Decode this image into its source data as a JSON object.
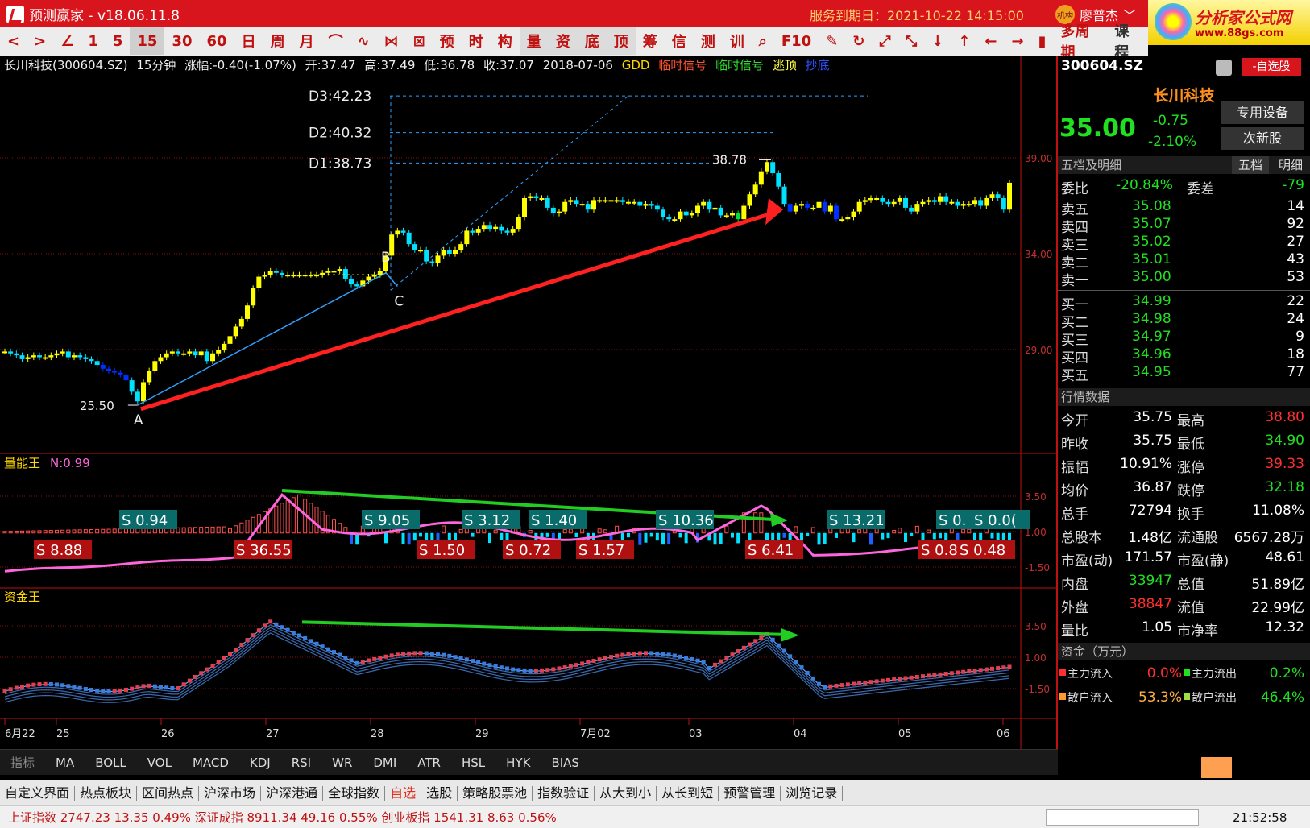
{
  "app": {
    "title": "预测赢家 - v18.06.11.8",
    "service_label": "服务到期日：2021-10-22 14:15:00",
    "user": "廖普杰",
    "user_badge": "机构",
    "ad_title": "分析家公式网",
    "ad_url": "www.88gs.com"
  },
  "toolbar": {
    "items": [
      "<",
      ">",
      "∠",
      "1",
      "5",
      "15",
      "30",
      "60",
      "日",
      "周",
      "月",
      "⌒",
      "∿",
      "⋈",
      "⊠",
      "预",
      "时",
      "构",
      "量",
      "资",
      "底",
      "顶",
      "筹",
      "信",
      "测",
      "训",
      "⌕",
      "F10",
      "✎",
      "↻",
      "⤢",
      "⤡",
      "↓",
      "↑",
      "←",
      "→",
      "▮",
      "多周期"
    ],
    "active_index": 5,
    "right_label": "课程"
  },
  "infobar": {
    "name": "长川科技(300604.SZ)",
    "period": "15分钟",
    "change": "涨幅:-0.40(-1.07%)",
    "open": "开:37.47",
    "high": "高:37.49",
    "low": "低:36.78",
    "close": "收:37.07",
    "date": "2018-07-06",
    "gdd": "GDD",
    "sig1": "临时信号",
    "sig2": "临时信号",
    "sig3": "逃顶",
    "sig4": "抄底"
  },
  "chart_data": [
    {
      "type": "candlestick",
      "title": "长川科技(300604.SZ) 15分钟",
      "ylim": [
        25.0,
        43.0
      ],
      "y_ticks": [
        "39.00",
        "34.00",
        "29.00"
      ],
      "x_ticks": [
        "6月22",
        "25",
        "26",
        "27",
        "28",
        "29",
        "7月02",
        "03",
        "04",
        "05",
        "06"
      ],
      "close": [
        28.9,
        28.8,
        28.7,
        28.5,
        28.6,
        28.7,
        28.6,
        28.6,
        28.7,
        28.8,
        28.9,
        28.6,
        28.7,
        28.6,
        28.5,
        28.4,
        28.2,
        28.0,
        27.9,
        27.8,
        27.7,
        27.4,
        26.8,
        26.3,
        27.3,
        27.9,
        28.4,
        28.6,
        28.8,
        28.9,
        28.8,
        28.8,
        28.9,
        28.7,
        28.9,
        28.4,
        28.8,
        29.0,
        29.3,
        29.7,
        30.2,
        30.6,
        31.3,
        32.2,
        32.8,
        32.9,
        33.1,
        33.0,
        32.9,
        32.9,
        32.9,
        32.9,
        32.9,
        32.9,
        32.9,
        33.0,
        33.1,
        33.1,
        33.2,
        32.7,
        32.4,
        32.3,
        32.6,
        32.8,
        32.9,
        33.1,
        33.9,
        35.0,
        35.2,
        35.1,
        34.5,
        34.2,
        34.2,
        33.6,
        33.5,
        33.9,
        34.2,
        34.0,
        34.2,
        34.5,
        35.2,
        35.1,
        35.3,
        35.5,
        35.3,
        35.4,
        35.2,
        35.1,
        35.3,
        35.9,
        36.9,
        37.0,
        36.9,
        36.9,
        36.4,
        36.1,
        36.2,
        36.7,
        36.8,
        36.6,
        36.6,
        36.3,
        36.8,
        36.8,
        36.8,
        36.8,
        36.8,
        36.7,
        36.7,
        36.7,
        36.5,
        36.6,
        36.5,
        36.3,
        35.9,
        35.8,
        35.8,
        36.2,
        36.0,
        36.1,
        36.5,
        36.7,
        36.3,
        36.4,
        36.0,
        36.0,
        36.1,
        35.8,
        36.5,
        37.1,
        37.6,
        38.3,
        38.78,
        38.2,
        37.5,
        36.6,
        36.2,
        36.5,
        36.6,
        36.4,
        36.4,
        36.7,
        36.2,
        36.5,
        35.8,
        35.8,
        35.9,
        36.2,
        36.7,
        36.8,
        36.9,
        36.9,
        36.7,
        36.6,
        36.7,
        36.9,
        36.4,
        36.2,
        36.6,
        36.7,
        36.8,
        36.7,
        37.0,
        36.7,
        36.7,
        36.5,
        36.6,
        36.6,
        36.8,
        36.5,
        36.9,
        37.1,
        36.9,
        36.3,
        37.7
      ]
    },
    {
      "type": "bar",
      "title": "量能王",
      "param": "N:0.99",
      "y_ticks": [
        "3.50",
        "1.00",
        "-1.50"
      ],
      "ylim": [
        -2.4,
        4.6
      ]
    },
    {
      "type": "bar",
      "title": "资金王",
      "y_ticks": [
        "3.50",
        "1.00",
        "-1.50"
      ],
      "ylim": [
        -2.4,
        4.6
      ]
    }
  ],
  "annotations": {
    "d_levels": [
      {
        "label": "D3:42.23",
        "value": 42.23
      },
      {
        "label": "D2:40.32",
        "value": 40.32
      },
      {
        "label": "D1:38.73",
        "value": 38.73
      }
    ],
    "points": [
      {
        "label": "A",
        "value": "25.50"
      },
      {
        "label": "B"
      },
      {
        "label": "C"
      }
    ],
    "peak_label": "38.78",
    "vol_s_labels": [
      "0.94",
      "9.05",
      "3.12",
      "1.40",
      "10.36",
      "13.21",
      "0.",
      "0.0("
    ],
    "vol_r_labels": [
      "8.88",
      "36.55",
      "1.50",
      "0.72",
      "1.57",
      "6.41",
      "0.8",
      "0.48"
    ]
  },
  "panel": {
    "code": "300604.SZ",
    "fav_btn": "-自选股",
    "name": "长川科技",
    "price": "35.00",
    "change": "-0.75",
    "change_pct": "-2.10%",
    "tag1": "专用设备",
    "tag2": "次新股",
    "orderbook_header": "五档及明细",
    "tab1": "五档",
    "tab2": "明细",
    "weibi_label": "委比",
    "weibi": "-20.84%",
    "weicha_label": "委差",
    "weicha": "-79",
    "asks": [
      [
        "卖五",
        "35.08",
        "14"
      ],
      [
        "卖四",
        "35.07",
        "92"
      ],
      [
        "卖三",
        "35.02",
        "27"
      ],
      [
        "卖二",
        "35.01",
        "43"
      ],
      [
        "卖一",
        "35.00",
        "53"
      ]
    ],
    "bids": [
      [
        "买一",
        "34.99",
        "22"
      ],
      [
        "买二",
        "34.98",
        "24"
      ],
      [
        "买三",
        "34.97",
        "9"
      ],
      [
        "买四",
        "34.96",
        "18"
      ],
      [
        "买五",
        "34.95",
        "77"
      ]
    ],
    "quote_header": "行情数据",
    "quotes": [
      [
        "今开",
        "35.75",
        "最高",
        "38.80"
      ],
      [
        "昨收",
        "35.75",
        "最低",
        "34.90"
      ],
      [
        "振幅",
        "10.91%",
        "涨停",
        "39.33"
      ],
      [
        "均价",
        "36.87",
        "跌停",
        "32.18"
      ],
      [
        "总手",
        "72794",
        "换手",
        "11.08%"
      ],
      [
        "总股本",
        "1.48亿",
        "流通股",
        "6567.28万"
      ],
      [
        "市盈(动)",
        "171.57",
        "市盈(静)",
        "48.61"
      ],
      [
        "内盘",
        "33947",
        "总值",
        "51.89亿"
      ],
      [
        "外盘",
        "38847",
        "流值",
        "22.99亿"
      ],
      [
        "量比",
        "1.05",
        "市净率",
        "12.32"
      ]
    ],
    "fund_header": "资金（万元）",
    "fund": [
      [
        "主力流入",
        "0.0%",
        "主力流出",
        "0.2%"
      ],
      [
        "散户流入",
        "53.3%",
        "散户流出",
        "46.4%"
      ]
    ]
  },
  "indicator_tabs": {
    "label": "指标",
    "items": [
      "MA",
      "BOLL",
      "VOL",
      "MACD",
      "KDJ",
      "RSI",
      "WR",
      "DMI",
      "ATR",
      "HSL",
      "HYK",
      "BIAS"
    ]
  },
  "navbar": {
    "items": [
      "自定义界面",
      "热点板块",
      "区间热点",
      "沪深市场",
      "沪深港通",
      "全球指数",
      "自选",
      "选股",
      "策略股票池",
      "指数验证",
      "从大到小",
      "从长到短",
      "预警管理",
      "浏览记录"
    ],
    "current_index": 6
  },
  "statusbar": {
    "indices": "上证指数 2747.23 13.35 0.49%   深证成指 8911.34 49.16 0.55%   创业板指 1541.31 8.63 0.56%",
    "clock": "21:52:58"
  },
  "colors": {
    "up": "#ffff00",
    "down": "#00e0ff",
    "down2": "#0030ff",
    "accent": "#d8151c",
    "line_blue": "#2ea0ff",
    "pink": "#ff66dd",
    "green": "#22cc22"
  }
}
